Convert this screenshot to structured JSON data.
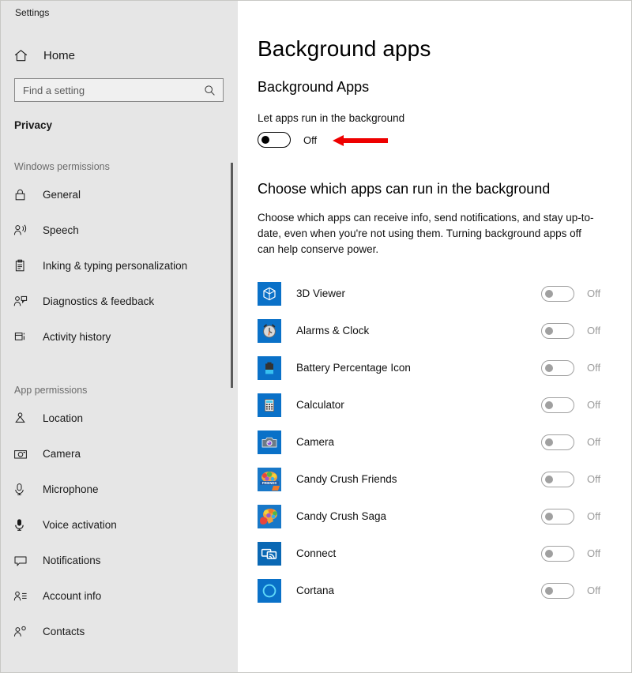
{
  "window": {
    "title": "Settings"
  },
  "sidebar": {
    "home": {
      "label": "Home",
      "icon": "home-icon"
    },
    "search": {
      "placeholder": "Find a setting",
      "value": "",
      "icon": "search-icon"
    },
    "active_section": "Privacy",
    "groups": [
      {
        "header": "Windows permissions",
        "items": [
          {
            "label": "General",
            "icon": "lock-icon"
          },
          {
            "label": "Speech",
            "icon": "speech-person-icon"
          },
          {
            "label": "Inking & typing personalization",
            "icon": "clipboard-pen-icon"
          },
          {
            "label": "Diagnostics & feedback",
            "icon": "person-feedback-icon"
          },
          {
            "label": "Activity history",
            "icon": "activity-history-icon"
          }
        ]
      },
      {
        "header": "App permissions",
        "items": [
          {
            "label": "Location",
            "icon": "location-pin-icon"
          },
          {
            "label": "Camera",
            "icon": "camera-icon"
          },
          {
            "label": "Microphone",
            "icon": "microphone-icon"
          },
          {
            "label": "Voice activation",
            "icon": "voice-activation-icon"
          },
          {
            "label": "Notifications",
            "icon": "notification-bubble-icon"
          },
          {
            "label": "Account info",
            "icon": "account-info-icon"
          },
          {
            "label": "Contacts",
            "icon": "contacts-icon"
          }
        ]
      }
    ]
  },
  "main": {
    "page_title": "Background apps",
    "section_title": "Background Apps",
    "master_toggle": {
      "label": "Let apps run in the background",
      "state": "Off",
      "on": false
    },
    "annotation": {
      "type": "arrow",
      "color": "#ee0000",
      "points_to": "master-toggle-state"
    },
    "choose_title": "Choose which apps can run in the background",
    "choose_description": "Choose which apps can receive info, send notifications, and stay up-to-date, even when you're not using them. Turning background apps off can help conserve power.",
    "apps": [
      {
        "name": "3D Viewer",
        "state": "Off",
        "on": false,
        "icon": "cube-3d-icon",
        "icon_bg": "#0a71c8"
      },
      {
        "name": "Alarms & Clock",
        "state": "Off",
        "on": false,
        "icon": "alarm-clock-icon",
        "icon_bg": "#0a71c8"
      },
      {
        "name": "Battery Percentage Icon",
        "state": "Off",
        "on": false,
        "icon": "battery-icon",
        "icon_bg": "#0a71c8"
      },
      {
        "name": "Calculator",
        "state": "Off",
        "on": false,
        "icon": "calculator-icon",
        "icon_bg": "#0a71c8"
      },
      {
        "name": "Camera",
        "state": "Off",
        "on": false,
        "icon": "camera-app-icon",
        "icon_bg": "#0a71c8"
      },
      {
        "name": "Candy Crush Friends",
        "state": "Off",
        "on": false,
        "icon": "candy-crush-friends-icon",
        "icon_bg": "#1878c8"
      },
      {
        "name": "Candy Crush Saga",
        "state": "Off",
        "on": false,
        "icon": "candy-crush-saga-icon",
        "icon_bg": "#1878c8"
      },
      {
        "name": "Connect",
        "state": "Off",
        "on": false,
        "icon": "connect-cast-icon",
        "icon_bg": "#0a68b4"
      },
      {
        "name": "Cortana",
        "state": "Off",
        "on": false,
        "icon": "cortana-ring-icon",
        "icon_bg": "#0a71c8"
      }
    ]
  },
  "colors": {
    "sidebar_bg": "#e6e6e6",
    "accent_blue": "#0a71c8",
    "annotation_red": "#ee0000",
    "disabled_gray": "#a0a0a0"
  }
}
